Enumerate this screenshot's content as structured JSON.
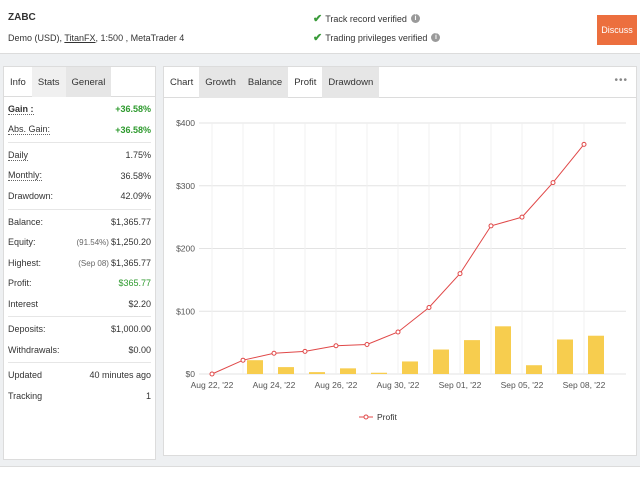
{
  "account": {
    "name": "ZABC",
    "type_prefix": "Demo (USD),",
    "broker": "TitanFX",
    "details": ", 1:500 , MetaTrader 4"
  },
  "verification": {
    "track_record": "Track record verified",
    "trading_privileges": "Trading privileges verified"
  },
  "discuss_label": "Discuss",
  "left_tabs": [
    "Info",
    "Stats",
    "General"
  ],
  "stats": {
    "gain_label": "Gain :",
    "gain": "+36.58%",
    "abs_gain_label": "Abs. Gain:",
    "abs_gain": "+36.58%",
    "daily_label": "Daily",
    "daily": "1.75%",
    "monthly_label": "Monthly:",
    "monthly": "36.58%",
    "drawdown_label": "Drawdown:",
    "drawdown": "42.09%",
    "balance_label": "Balance:",
    "balance": "$1,365.77",
    "equity_label": "Equity:",
    "equity_note": "(91.54%)",
    "equity": "$1,250.20",
    "highest_label": "Highest:",
    "highest_note": "(Sep 08)",
    "highest": "$1,365.77",
    "profit_label": "Profit:",
    "profit": "$365.77",
    "interest_label": "Interest",
    "interest": "$2.20",
    "deposits_label": "Deposits:",
    "deposits": "$1,000.00",
    "withdrawals_label": "Withdrawals:",
    "withdrawals": "$0.00",
    "updated_label": "Updated",
    "updated": "40 minutes ago",
    "tracking_label": "Tracking",
    "tracking": "1"
  },
  "right_tabs": [
    "Chart",
    "Growth",
    "Balance",
    "Profit",
    "Drawdown"
  ],
  "more_icon": "more-dots-icon",
  "colors": {
    "accent": "#ec6f3e",
    "green": "#2e9a2e",
    "line": "#e04848",
    "bar": "#f7cd4e"
  },
  "chart_data": {
    "type": "line",
    "x_tick_labels": [
      "Aug 22, '22",
      "Aug 24, '22",
      "Aug 26, '22",
      "Aug 30, '22",
      "Sep 01, '22",
      "Sep 05, '22",
      "Sep 08, '22"
    ],
    "y_tick_labels": [
      "$0",
      "$100",
      "$200",
      "$300",
      "$400"
    ],
    "ylim": [
      0,
      400
    ],
    "grid": true,
    "legend": "bottom",
    "series": [
      {
        "name": "Profit",
        "type": "line",
        "values": [
          0,
          22,
          33,
          36,
          45,
          47,
          67,
          106,
          160,
          236,
          250,
          305,
          366
        ]
      },
      {
        "type": "bar",
        "values": [
          null,
          22,
          11,
          3,
          9,
          2,
          20,
          39,
          54,
          76,
          14,
          55,
          61
        ]
      }
    ]
  }
}
